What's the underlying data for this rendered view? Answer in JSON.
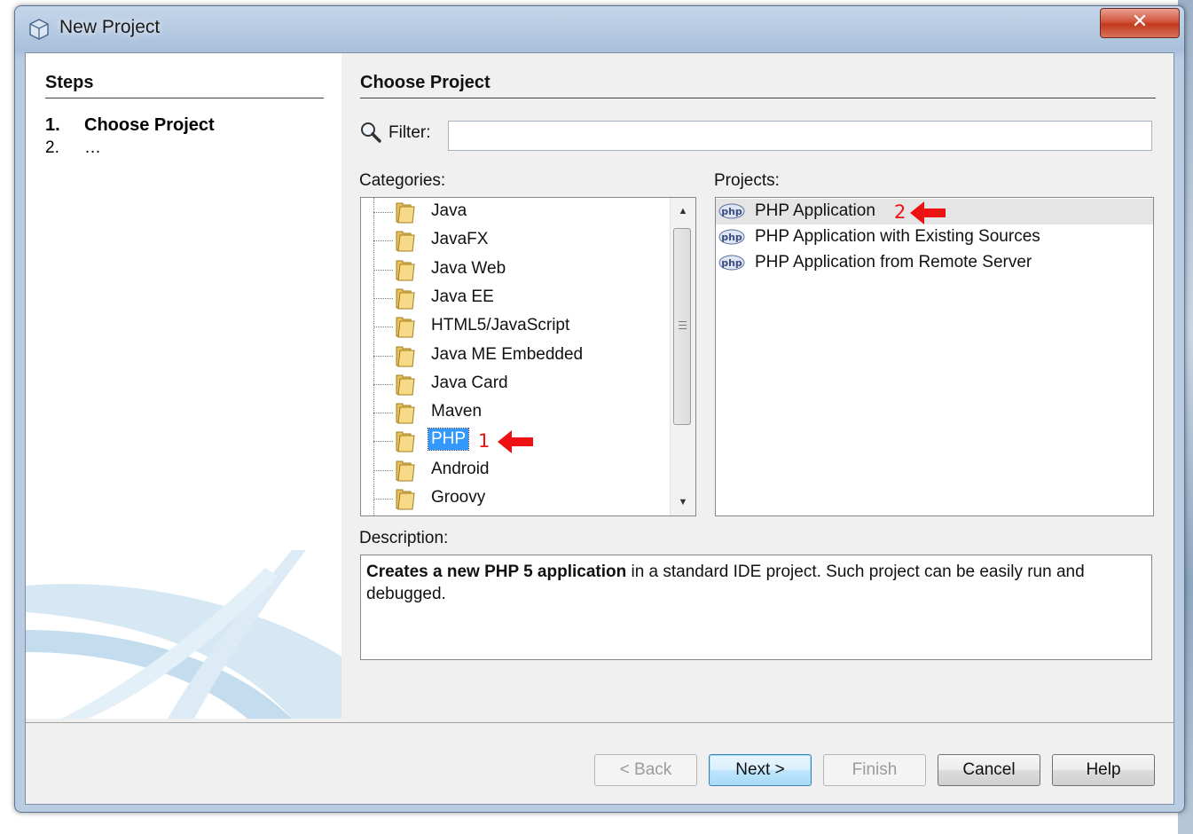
{
  "window": {
    "title": "New Project",
    "close_label": "✕"
  },
  "steps": {
    "title": "Steps",
    "items": [
      {
        "number": "1.",
        "label": "Choose Project"
      },
      {
        "number": "2.",
        "label": "…"
      }
    ]
  },
  "main": {
    "title": "Choose Project",
    "filter": {
      "label": "Filter:",
      "value": "",
      "placeholder": ""
    },
    "categories_label": "Categories:",
    "categories": [
      "Java",
      "JavaFX",
      "Java Web",
      "Java EE",
      "HTML5/JavaScript",
      "Java ME Embedded",
      "Java Card",
      "Maven",
      "PHP",
      "Android",
      "Groovy"
    ],
    "selected_category": "PHP",
    "projects_label": "Projects:",
    "projects": [
      "PHP Application",
      "PHP Application with Existing Sources",
      "PHP Application from Remote Server"
    ],
    "highlighted_project": "PHP Application",
    "description_label": "Description:",
    "description_bold": "Creates a new PHP 5 application",
    "description_rest": " in a standard IDE project. Such project can be easily run and debugged."
  },
  "annotations": {
    "marker_1": "1",
    "marker_2": "2",
    "color": "#ee1111"
  },
  "buttons": {
    "back": "< Back",
    "next": "Next >",
    "finish": "Finish",
    "cancel": "Cancel",
    "help": "Help"
  },
  "colors": {
    "selection": "#3399ff",
    "title_bar": "#b9cce2",
    "close_button": "#c23a1e"
  }
}
